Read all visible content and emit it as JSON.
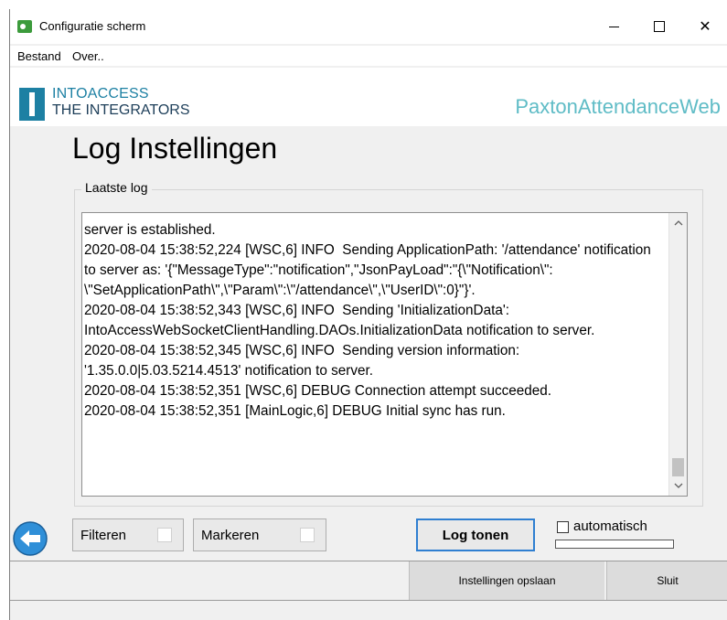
{
  "window": {
    "title": "Configuratie scherm",
    "controls": {
      "minimize": "minimize",
      "maximize": "maximize",
      "close": "✕"
    }
  },
  "menu": {
    "items": [
      "Bestand",
      "Over.."
    ]
  },
  "banner": {
    "logo_line1": "INTOACCESS",
    "logo_line2": "THE INTEGRATORS",
    "app_name": "PaxtonAttendanceWeb"
  },
  "page": {
    "title": "Log Instellingen"
  },
  "log": {
    "group_label": "Laatste log",
    "text": "server is established.\n2020-08-04 15:38:52,224 [WSC,6] INFO  Sending ApplicationPath: '/attendance' notification to server as: '{\"MessageType\":\"notification\",\"JsonPayLoad\":\"{\\\"Notification\\\": \\\"SetApplicationPath\\\",\\\"Param\\\":\\\"/attendance\\\",\\\"UserID\\\":0}\"}'.\n2020-08-04 15:38:52,343 [WSC,6] INFO  Sending 'InitializationData': IntoAccessWebSocketClientHandling.DAOs.InitializationData notification to server.\n2020-08-04 15:38:52,345 [WSC,6] INFO  Sending version information: '1.35.0.0|5.03.5214.4513' notification to server.\n2020-08-04 15:38:52,351 [WSC,6] DEBUG Connection attempt succeeded.\n2020-08-04 15:38:52,351 [MainLogic,6] DEBUG Initial sync has run."
  },
  "controls": {
    "filter_label": "Filteren",
    "mark_label": "Markeren",
    "show_log_label": "Log tonen",
    "auto_label": "automatisch",
    "progress_fraction": 0
  },
  "footer": {
    "save_label": "Instellingen opslaan",
    "close_label": "Sluit"
  },
  "colors": {
    "brand_blue": "#1d80a3",
    "app_name_teal": "#5fbcc6",
    "focus_border": "#2f7fd1"
  }
}
